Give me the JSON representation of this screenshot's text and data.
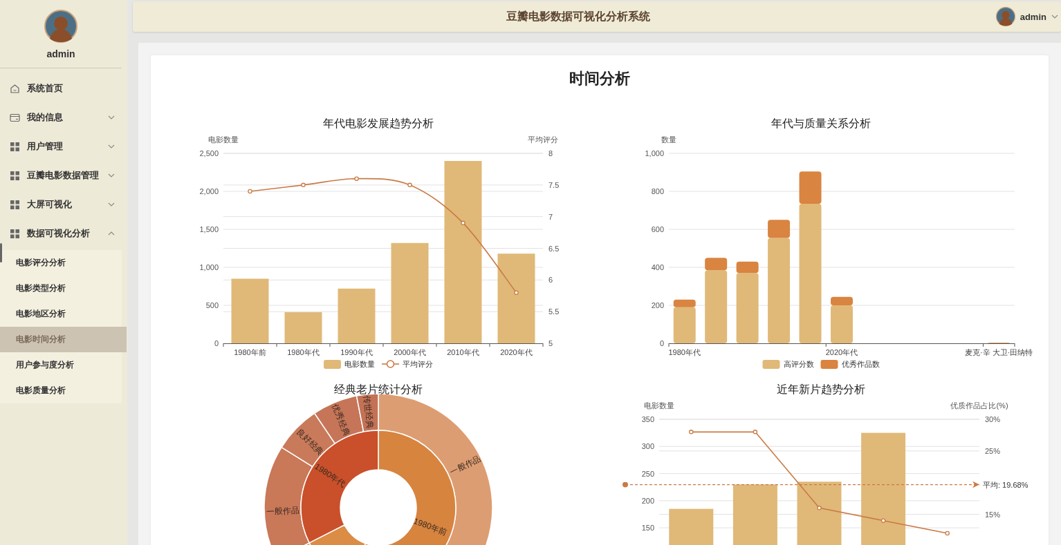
{
  "sidebar": {
    "user": {
      "name": "admin"
    },
    "items": [
      {
        "kind": "link",
        "label": "系统首页"
      },
      {
        "kind": "group",
        "label": "我的信息",
        "expanded": false
      },
      {
        "kind": "group",
        "label": "用户管理",
        "expanded": false
      },
      {
        "kind": "group",
        "label": "豆瓣电影数据管理",
        "expanded": false
      },
      {
        "kind": "group",
        "label": "大屏可视化",
        "expanded": false
      },
      {
        "kind": "group",
        "label": "数据可视化分析",
        "expanded": true,
        "children": [
          {
            "label": "电影评分分析",
            "selected": false
          },
          {
            "label": "电影类型分析",
            "selected": false
          },
          {
            "label": "电影地区分析",
            "selected": false
          },
          {
            "label": "电影时间分析",
            "selected": true
          },
          {
            "label": "用户参与度分析",
            "selected": false
          },
          {
            "label": "电影质量分析",
            "selected": false
          }
        ]
      }
    ]
  },
  "header": {
    "title": "豆瓣电影数据可视化分析系统",
    "user": {
      "name": "admin"
    }
  },
  "page": {
    "title": "时间分析",
    "charts": [
      {
        "kind": "chart",
        "chart_data": {
          "type": "bar",
          "title": "年代电影发展趋势分析",
          "ylabel": "电影数量",
          "y2label": "平均评分",
          "grid": true,
          "legend": "bottom",
          "categories": [
            "1980年前",
            "1980年代",
            "1990年代",
            "2000年代",
            "2010年代",
            "2020年代"
          ],
          "series": [
            {
              "name": "电影数量",
              "type": "bar",
              "color": "#e0b978",
              "values": [
                850,
                410,
                720,
                1320,
                2400,
                1180
              ]
            },
            {
              "name": "平均评分",
              "type": "line",
              "axis": "y2",
              "marker": "circle",
              "color": "#c97a45",
              "values": [
                7.4,
                7.5,
                7.6,
                7.5,
                6.9,
                5.8
              ]
            }
          ],
          "ylim": [
            0,
            2500
          ],
          "yticks": [
            0,
            500,
            {
              "value": 1000,
              "label": "1,000"
            },
            {
              "value": 1500,
              "label": "1,500"
            },
            {
              "value": 2000,
              "label": "2,000"
            },
            {
              "value": 2500,
              "label": "2,500"
            }
          ],
          "y2lim": [
            5,
            8
          ],
          "y2ticks": [
            5,
            5.5,
            6,
            6.5,
            7,
            7.5,
            8
          ]
        }
      },
      {
        "kind": "chart",
        "chart_data": {
          "type": "bar",
          "stacked": true,
          "title": "年代与质量关系分析",
          "ylabel": "数量",
          "grid": true,
          "legend": "bottom",
          "categories": [
            "1980年代",
            null,
            null,
            null,
            null,
            "2020年代",
            null,
            null,
            null,
            null,
            "麦克·辛 大卫·田纳特"
          ],
          "series": [
            {
              "name": "高评分数",
              "type": "bar",
              "color": "#e0b978",
              "values": [
                190,
                385,
                370,
                555,
                735,
                200,
                null,
                null,
                null,
                null,
                2
              ]
            },
            {
              "name": "优秀作品数",
              "type": "bar",
              "color": "#d98440",
              "values": [
                40,
                65,
                60,
                95,
                170,
                45,
                null,
                null,
                null,
                null,
                1
              ]
            }
          ],
          "ylim": [
            0,
            1000
          ],
          "yticks": [
            0,
            200,
            400,
            600,
            800,
            {
              "value": 1000,
              "label": "1,000"
            }
          ]
        }
      },
      {
        "kind": "sunburst",
        "title": "经典老片统计分析",
        "inner_labels": [
          "1980年前",
          "1980年代"
        ],
        "outer_labels": [
          "一般作品",
          "一般作品",
          "良好经典",
          "优秀经典",
          "传世经典"
        ]
      },
      {
        "kind": "chart",
        "chart_data": {
          "type": "bar",
          "title": "近年新片趋势分析",
          "ylabel": "电影数量",
          "y2label": "优质作品占比(%)",
          "grid": true,
          "series": [
            {
              "type": "bar",
              "color": "#e0b978",
              "values": [
                185,
                230,
                235,
                325,
                null
              ]
            },
            {
              "type": "line",
              "axis": "y2",
              "marker": "circle",
              "color": "#c97a45",
              "values": [
                28,
                28,
                16,
                14,
                12
              ]
            }
          ],
          "ylim": [
            0,
            350
          ],
          "yticks": [
            150,
            200,
            250,
            300,
            350
          ],
          "y2lim": [
            0,
            30
          ],
          "y2ticks": [
            {
              "value": 15,
              "label": "15%"
            },
            {
              "value": 25,
              "label": "25%"
            },
            {
              "value": 30,
              "label": "30%"
            }
          ],
          "ref_lines": [
            {
              "axis": "y2",
              "value": 19.68,
              "label": "平均: 19.68%"
            }
          ]
        }
      }
    ]
  }
}
